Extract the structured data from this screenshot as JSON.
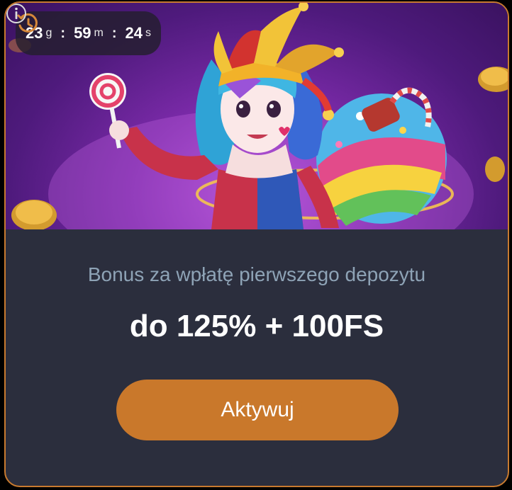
{
  "timer": {
    "days": "23",
    "days_unit": "g",
    "hours": "59",
    "hours_unit": "m",
    "seconds": "24",
    "seconds_unit": "s",
    "separator": ":",
    "icon": "history-clock-icon"
  },
  "info": {
    "icon": "info-icon"
  },
  "offer": {
    "subtitle": "Bonus za wpłatę pierwszego depozytu",
    "headline": "do 125% + 100FS"
  },
  "cta": {
    "label": "Aktywuj"
  },
  "colors": {
    "accent": "#c9782b",
    "card_border": "#c87a2f",
    "card_bg": "#2b2e3d",
    "subtitle": "#8ea3b6"
  }
}
